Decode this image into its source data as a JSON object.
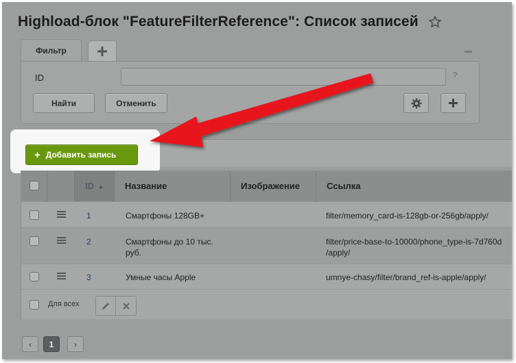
{
  "page": {
    "title": "Highload-блок \"FeatureFilterReference\": Список записей"
  },
  "filter": {
    "tab_label": "Фильтр",
    "field_label": "ID",
    "field_value": "",
    "help_label": "?",
    "find_label": "Найти",
    "cancel_label": "Отменить"
  },
  "toolbar": {
    "add_record_label": "Добавить запись"
  },
  "table": {
    "columns": [
      "ID",
      "Название",
      "Изображение",
      "Ссылка"
    ],
    "rows": [
      {
        "id": "1",
        "name": "Смартфоны 128GB+",
        "image": "",
        "link": "filter/memory_card-is-128gb-or-256gb/apply/"
      },
      {
        "id": "2",
        "name_line1": "Смартфоны до 10 тыс.",
        "name_line2": "руб.",
        "image": "",
        "link_line1": "filter/price-base-to-10000/phone_type-is-7d760d",
        "link_line2": "/apply/"
      },
      {
        "id": "3",
        "name": "Умные часы Apple",
        "image": "",
        "link": "umnye-chasy/filter/brand_ref-is-apple/apply/"
      }
    ],
    "footer_label": "Для всех"
  },
  "pagination": {
    "prev": "‹",
    "current": "1",
    "next": "›"
  },
  "colors": {
    "accent_green": "#6a980d",
    "arrow_red": "#e8141a",
    "page_overlay": "#9c9d9d"
  },
  "icons": [
    "star-icon",
    "plus-icon",
    "gear-icon",
    "hamburger-icon",
    "pencil-icon",
    "close-icon",
    "sort-up-icon"
  ]
}
